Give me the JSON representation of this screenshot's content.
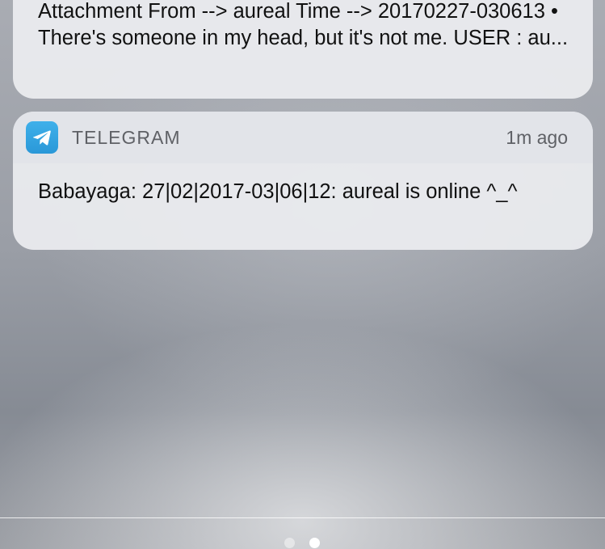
{
  "notifications": [
    {
      "body": "Attachment From --> aureal Time --> 20170227-030613 • There's someone in my head, but it's not me. USER : au..."
    },
    {
      "app_name": "TELEGRAM",
      "app_icon": "telegram-icon",
      "time": "1m ago",
      "message": "Babayaga: 27|02|2017-03|06|12: aureal is online ^_^"
    }
  ],
  "page_indicator": {
    "pages": 2,
    "current": 2
  },
  "colors": {
    "telegram_blue": "#2fa4e1",
    "card_background": "#eceef0",
    "secondary_text": "#5f6166"
  }
}
